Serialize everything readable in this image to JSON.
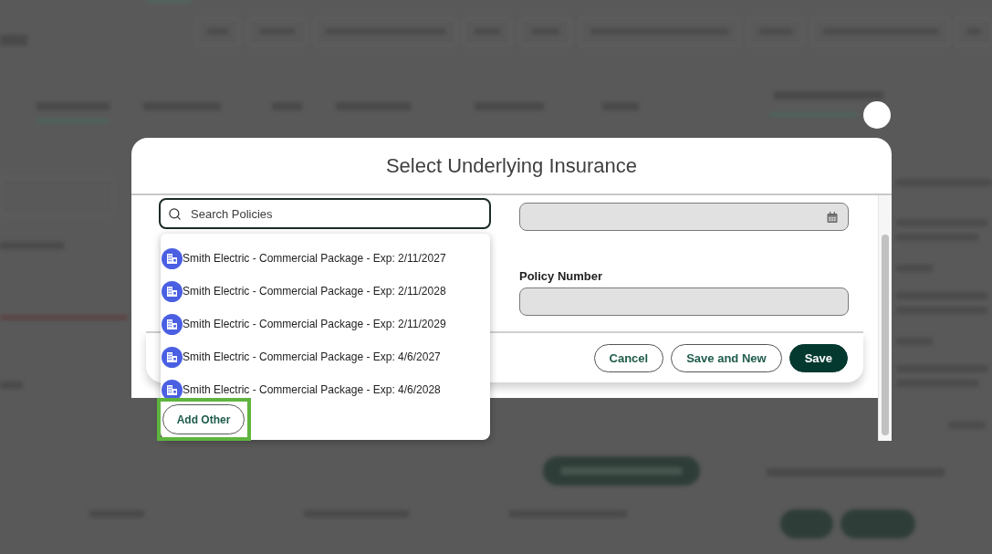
{
  "dialog": {
    "title": "Select Underlying Insurance"
  },
  "fields": [
    {
      "kind": "search",
      "placeholder": "Search Policies",
      "focused": true,
      "disabled": false
    },
    {
      "kind": "date",
      "focused": false,
      "disabled": true
    },
    {
      "kind": "text",
      "label": "Policy Number",
      "focused": false,
      "disabled": true
    }
  ],
  "dropdown": {
    "options": [
      "Smith Electric - Commercial Package - Exp: 2/11/2027",
      "Smith Electric - Commercial Package - Exp: 2/11/2028",
      "Smith Electric - Commercial Package - Exp: 2/11/2029",
      "Smith Electric - Commercial Package - Exp: 4/6/2027",
      "Smith Electric - Commercial Package - Exp: 4/6/2028"
    ],
    "add_button": {
      "label": "Add Other",
      "highlighted": true
    }
  },
  "footer_buttons": [
    {
      "kind": "secondary",
      "label": "Cancel"
    },
    {
      "kind": "secondary",
      "label": "Save and New"
    },
    {
      "kind": "primary",
      "label": "Save"
    }
  ]
}
